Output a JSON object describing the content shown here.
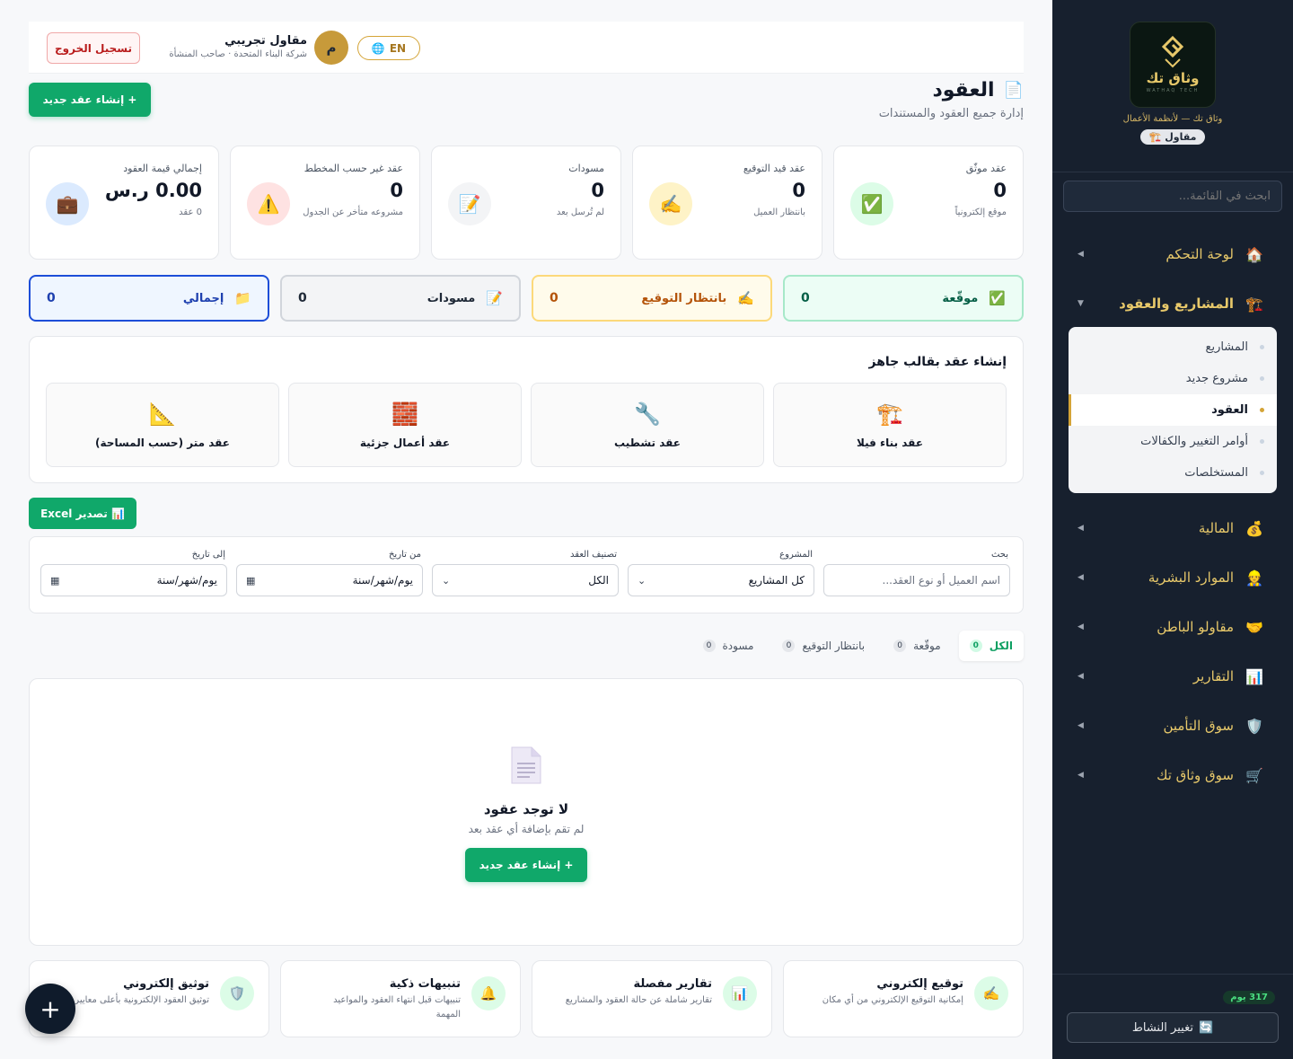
{
  "sidebar": {
    "logo_text": "وثاق تك",
    "logo_sub": "WATHAQ TECH",
    "tagline": "وثاق تك — لأنظمة الأعمال",
    "role": "مقاول",
    "search_placeholder": "ابحث في القائمة...",
    "nav": [
      {
        "label": "لوحة التحكم",
        "icon": "🏠"
      },
      {
        "label": "المشاريع والعقود",
        "icon": "🏗️"
      },
      {
        "label": "المالية",
        "icon": "💰"
      },
      {
        "label": "الموارد البشرية",
        "icon": "👷"
      },
      {
        "label": "مقاولو الباطن",
        "icon": "🤝"
      },
      {
        "label": "التقارير",
        "icon": "📊"
      },
      {
        "label": "سوق التأمين",
        "icon": "🛡️"
      },
      {
        "label": "سوق وثاق تك",
        "icon": "🛒"
      }
    ],
    "submenu": [
      "المشاريع",
      "مشروع جديد",
      "العقود",
      "أوامر التغيير والكفالات",
      "المستخلصات"
    ],
    "days_badge": "317 يوم",
    "change_activity": "تغيير النشاط"
  },
  "header": {
    "avatar_letter": "م",
    "user_name": "مقاول تجريبي",
    "user_sub": "شركة البناء المتحدة · صاحب المنشأة",
    "lang": "EN",
    "logout": "تسجيل الخروج"
  },
  "page": {
    "title": "العقود",
    "subtitle": "إدارة جميع العقود والمستندات",
    "create_button": "+ إنشاء عقد جديد"
  },
  "stats": [
    {
      "label": "عقد موثّق",
      "value": "0",
      "note": "موقع إلكترونياً",
      "icon": "✅",
      "bg": "#dcfce7"
    },
    {
      "label": "عقد قيد التوقيع",
      "value": "0",
      "note": "بانتظار العميل",
      "icon": "✍️",
      "bg": "#fef3c7"
    },
    {
      "label": "مسودات",
      "value": "0",
      "note": "لم تُرسل بعد",
      "icon": "📝",
      "bg": "#f3f4f6"
    },
    {
      "label": "عقد غير حسب المخطط",
      "value": "0",
      "note": "مشروعه متأخر عن الجدول",
      "icon": "⚠️",
      "bg": "#fee2e2"
    },
    {
      "label": "إجمالي قيمة العقود",
      "value": "0.00 ر.س",
      "note": "0 عقد",
      "icon": "💼",
      "bg": "#dbeafe"
    }
  ],
  "pills": [
    {
      "label": "موقّعة",
      "count": "0",
      "icon": "✅"
    },
    {
      "label": "بانتظار التوقيع",
      "count": "0",
      "icon": "✍️"
    },
    {
      "label": "مسودات",
      "count": "0",
      "icon": "📝"
    },
    {
      "label": "إجمالي",
      "count": "0",
      "icon": "📁"
    }
  ],
  "templates": {
    "title": "إنشاء عقد بقالب جاهز",
    "items": [
      {
        "label": "عقد بناء فيلا",
        "icon": "🏗️"
      },
      {
        "label": "عقد تشطيب",
        "icon": "🔧"
      },
      {
        "label": "عقد أعمال جزئية",
        "icon": "🧱"
      },
      {
        "label": "عقد متر (حسب المساحة)",
        "icon": "📐"
      }
    ]
  },
  "excel_button": "📊 تصدير Excel",
  "filters": {
    "search": {
      "label": "بحث",
      "placeholder": "اسم العميل أو نوع العقد..."
    },
    "project": {
      "label": "المشروع",
      "value": "كل المشاريع"
    },
    "category": {
      "label": "تصنيف العقد",
      "value": "الكل"
    },
    "from": {
      "label": "من تاريخ",
      "value": "يوم/شهر/سنة"
    },
    "to": {
      "label": "إلى تاريخ",
      "value": "يوم/شهر/سنة"
    }
  },
  "tabs": [
    {
      "label": "الكل",
      "count": "0"
    },
    {
      "label": "موقّعة",
      "count": "0"
    },
    {
      "label": "بانتظار التوقيع",
      "count": "0"
    },
    {
      "label": "مسودة",
      "count": "0"
    }
  ],
  "empty": {
    "title": "لا توجد عقود",
    "subtitle": "لم تقم بإضافة أي عقد بعد",
    "button": "+ إنشاء عقد جديد"
  },
  "features": [
    {
      "title": "توقيع إلكتروني",
      "desc": "إمكانية التوقيع الإلكتروني من أي مكان",
      "icon": "✍️"
    },
    {
      "title": "تقارير مفصلة",
      "desc": "تقارير شاملة عن حالة العقود والمشاريع",
      "icon": "📊"
    },
    {
      "title": "تنبيهات ذكية",
      "desc": "تنبيهات قبل انتهاء العقود والمواعيد المهمة",
      "icon": "🔔"
    },
    {
      "title": "توثيق إلكتروني",
      "desc": "توثيق العقود الإلكترونية بأعلى معايير الأمان",
      "icon": "🛡️"
    }
  ],
  "fab": "+",
  "colors": {
    "primary": "#10a86a",
    "sidebar": "#17202e",
    "gold": "#e7c86a"
  }
}
